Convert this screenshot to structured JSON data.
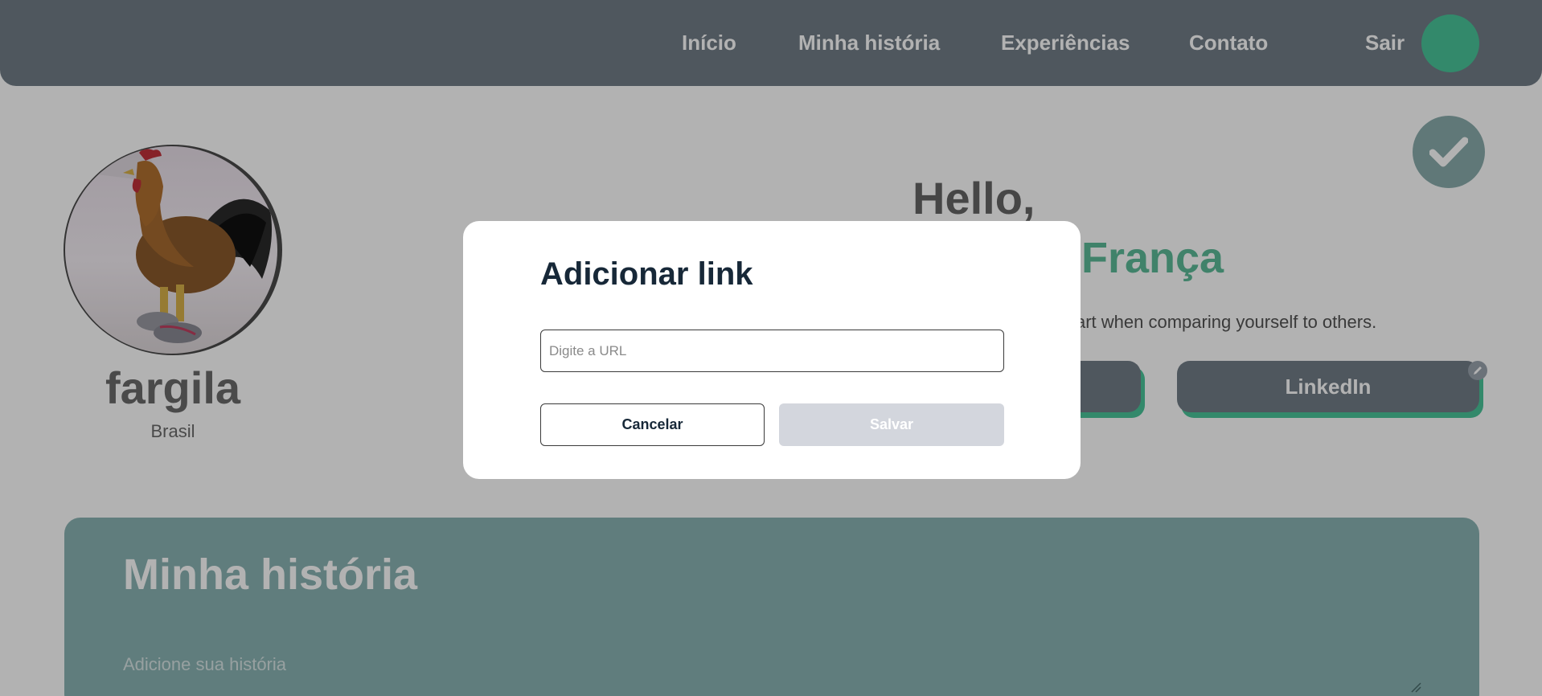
{
  "nav": {
    "items": [
      {
        "label": "Início"
      },
      {
        "label": "Minha história"
      },
      {
        "label": "Experiências"
      },
      {
        "label": "Contato"
      }
    ],
    "logout_label": "Sair"
  },
  "profile": {
    "username": "fargila",
    "country": "Brasil",
    "greeting": "Hello,",
    "fullname_visible": "França",
    "bio_visible": "art when comparing yourself to others."
  },
  "social": {
    "links": [
      {
        "label": ""
      },
      {
        "label": "LinkedIn"
      }
    ]
  },
  "story": {
    "title": "Minha história",
    "placeholder": "Adicione sua história"
  },
  "modal": {
    "title": "Adicionar link",
    "url_placeholder": "Digite a URL",
    "cancel_label": "Cancelar",
    "save_label": "Salvar"
  },
  "colors": {
    "navbar": "#717d87",
    "accent": "#49c59a",
    "story_bg": "#8ab3b3",
    "modal_title": "#172838",
    "save_disabled": "#d3d6dd"
  },
  "icons": {
    "confirm": "check-icon",
    "edit": "pencil-icon",
    "avatar": "rooster-photo"
  }
}
